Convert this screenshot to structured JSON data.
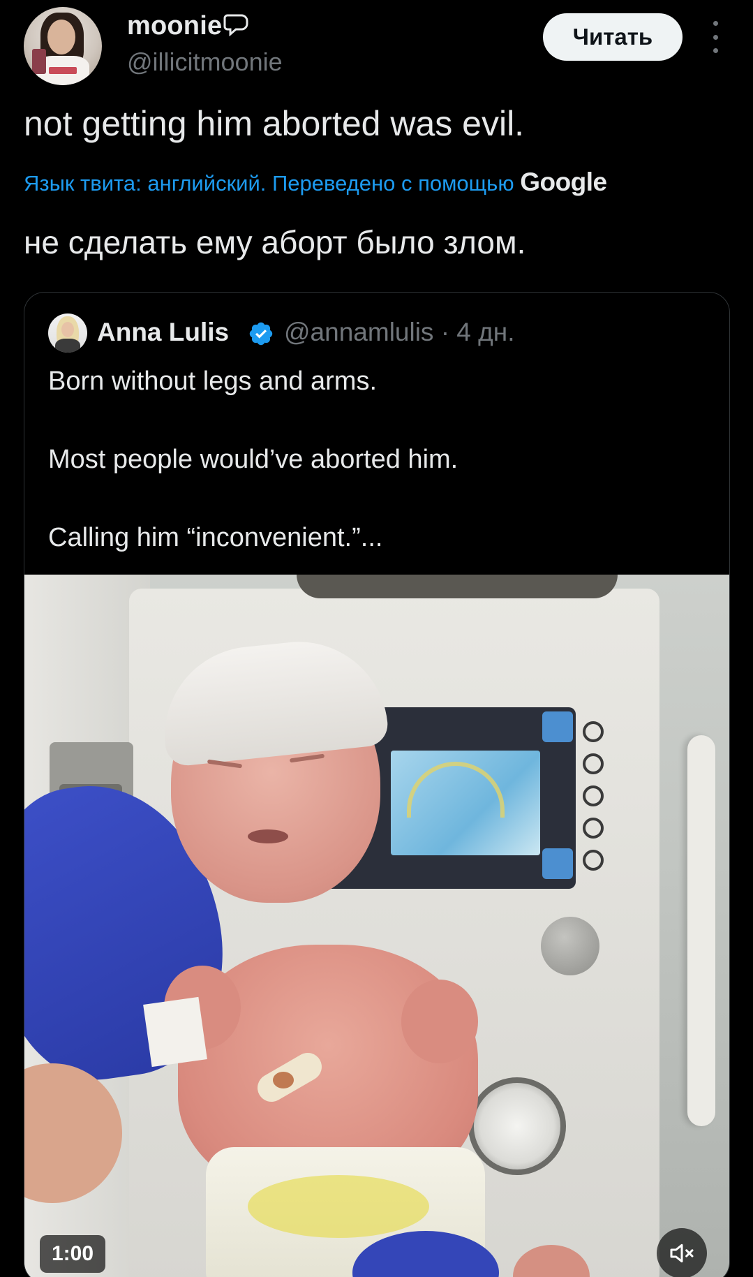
{
  "author": {
    "display_name": "moonie",
    "handle": "@illicitmoonie",
    "follow_label": "Читать"
  },
  "tweet": {
    "text": "not getting him aborted was evil.",
    "translation_note": "Язык твита: английский. Переведено с помощью ",
    "translation_provider": "Google",
    "translated_text": "не сделать ему аборт было злом."
  },
  "quoted": {
    "display_name": "Anna Lulis",
    "handle_and_time": "@annamlulis · 4 дн.",
    "line1": "Born without legs and arms.",
    "line2": "Most people would’ve aborted him.",
    "line3": "Calling him “inconvenient.”...",
    "video_duration": "1:00"
  },
  "icons": {
    "name_emoji": "speech-bubble-icon",
    "verified": "verified-badge-icon",
    "more": "more-options-icon",
    "mute": "muted-speaker-icon"
  },
  "colors": {
    "background": "#000000",
    "text": "#e7e9ea",
    "secondary_text": "#71767b",
    "accent": "#1d9bf0",
    "border": "#2f3336",
    "button_bg": "#eff3f4"
  }
}
